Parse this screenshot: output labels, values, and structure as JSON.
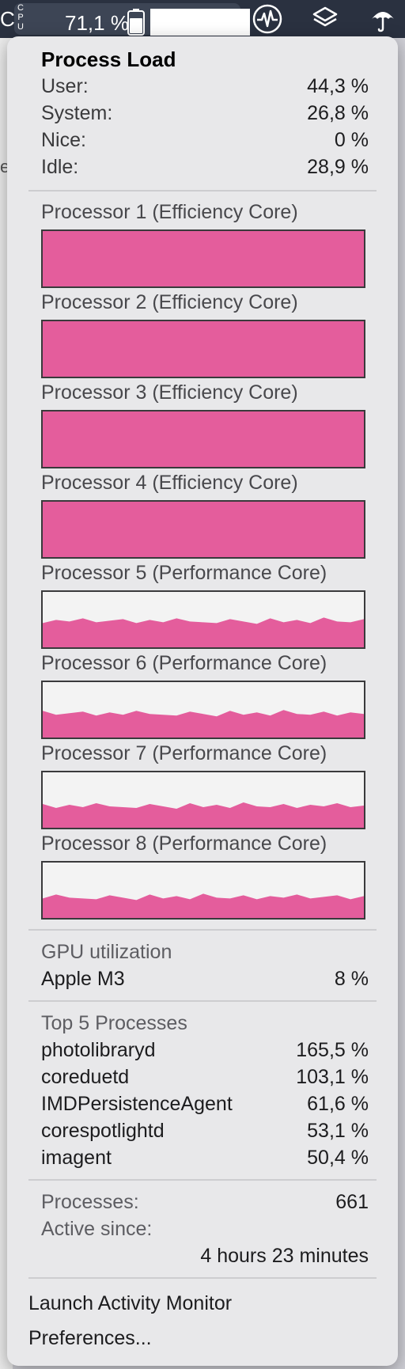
{
  "menubar": {
    "cpu_letter": "C",
    "cpu_stack": "CPU",
    "cpu_percent": "71,1 %",
    "icons": [
      "cpu-icon",
      "battery-icon",
      "activity-icon",
      "layers-icon",
      "umbrella-icon"
    ]
  },
  "background_fragment": "e",
  "process_load": {
    "title": "Process Load",
    "rows": [
      {
        "label": "User:",
        "value": "44,3 %"
      },
      {
        "label": "System:",
        "value": "26,8 %"
      },
      {
        "label": "Nice:",
        "value": "0 %"
      },
      {
        "label": "Idle:",
        "value": "28,9 %"
      }
    ]
  },
  "processors": [
    {
      "label": "Processor 1 (Efficiency Core)",
      "load": 1.0
    },
    {
      "label": "Processor 2 (Efficiency Core)",
      "load": 1.0
    },
    {
      "label": "Processor 3 (Efficiency Core)",
      "load": 1.0
    },
    {
      "label": "Processor 4 (Efficiency Core)",
      "load": 1.0
    },
    {
      "label": "Processor 5 (Performance Core)",
      "load": 0.48
    },
    {
      "label": "Processor 6 (Performance Core)",
      "load": 0.44
    },
    {
      "label": "Processor 7 (Performance Core)",
      "load": 0.4
    },
    {
      "label": "Processor 8 (Performance Core)",
      "load": 0.38
    }
  ],
  "graph_color": "#e45d9c",
  "gpu": {
    "title": "GPU utilization",
    "name": "Apple M3",
    "value": "8 %"
  },
  "top_processes": {
    "title": "Top 5 Processes",
    "items": [
      {
        "name": "photolibraryd",
        "value": "165,5 %"
      },
      {
        "name": "coreduetd",
        "value": "103,1 %"
      },
      {
        "name": "IMDPersistenceAgent",
        "value": "61,6 %"
      },
      {
        "name": "corespotlightd",
        "value": "53,1 %"
      },
      {
        "name": "imagent",
        "value": "50,4 %"
      }
    ]
  },
  "stats": {
    "processes_label": "Processes:",
    "processes_value": "661",
    "active_since_label": "Active since:",
    "active_since_value": "4 hours 23 minutes"
  },
  "actions": {
    "launch": "Launch Activity Monitor",
    "preferences": "Preferences..."
  }
}
